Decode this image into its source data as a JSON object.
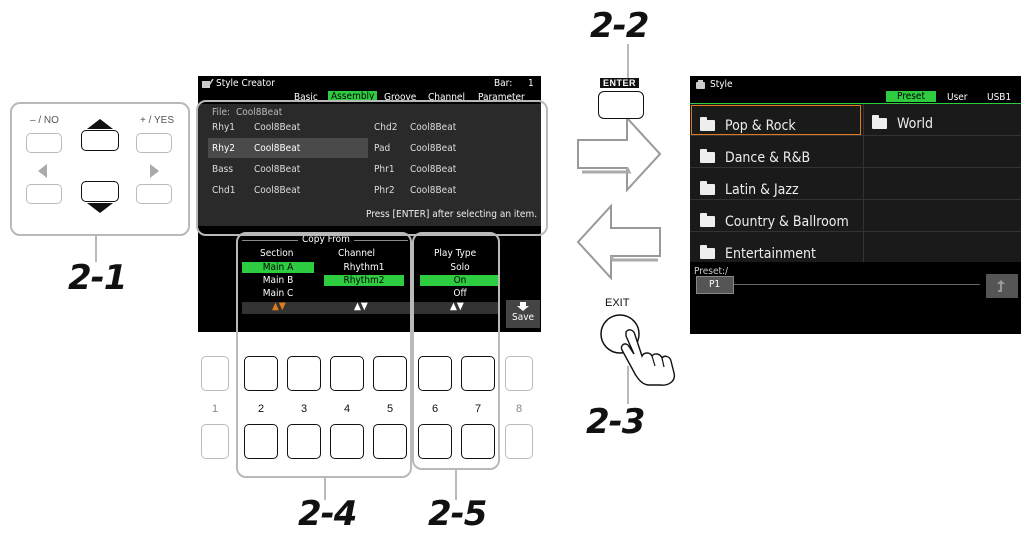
{
  "steps": {
    "s21": "2-1",
    "s22": "2-2",
    "s23": "2-3",
    "s24": "2-4",
    "s25": "2-5"
  },
  "keys": {
    "no": "– / NO",
    "yes": "+ / YES",
    "enter": "ENTER",
    "exit": "EXIT"
  },
  "lcd1": {
    "title": "Style Creator",
    "bar_label": "Bar:",
    "bar_value": "1",
    "tabs": [
      "Basic",
      "Assembly",
      "Groove",
      "Channel",
      "Parameter"
    ],
    "file_label": "File:",
    "file_value": "Cool8Beat",
    "rows_left": [
      {
        "part": "Rhy1",
        "style": "Cool8Beat"
      },
      {
        "part": "Rhy2",
        "style": "Cool8Beat"
      },
      {
        "part": "Bass",
        "style": "Cool8Beat"
      },
      {
        "part": "Chd1",
        "style": "Cool8Beat"
      }
    ],
    "rows_right": [
      {
        "part": "Chd2",
        "style": "Cool8Beat"
      },
      {
        "part": "Pad",
        "style": "Cool8Beat"
      },
      {
        "part": "Phr1",
        "style": "Cool8Beat"
      },
      {
        "part": "Phr2",
        "style": "Cool8Beat"
      }
    ],
    "hint": "Press [ENTER] after selecting an item.",
    "copy_from": "Copy From",
    "section_label": "Section",
    "sections": [
      "Main A",
      "Main B",
      "Main C"
    ],
    "channel_label": "Channel",
    "channels": [
      "Rhythm1",
      "Rhythm2"
    ],
    "playtype_label": "Play Type",
    "playtypes": [
      "Solo",
      "On",
      "Off"
    ],
    "save": "Save"
  },
  "panel_numbers": [
    "1",
    "2",
    "3",
    "4",
    "5",
    "6",
    "7",
    "8"
  ],
  "lcd2": {
    "title": "Style",
    "tabs": [
      "Preset",
      "User",
      "USB1"
    ],
    "folders_left": [
      "Pop & Rock",
      "Dance & R&B",
      "Latin & Jazz",
      "Country & Ballroom",
      "Entertainment"
    ],
    "folders_right": [
      "World"
    ],
    "path": "Preset:/",
    "page": "P1"
  },
  "colors": {
    "highlight": "#2ecc40",
    "selector": "#e07b1c",
    "arrow_orange": "#f08a20"
  }
}
